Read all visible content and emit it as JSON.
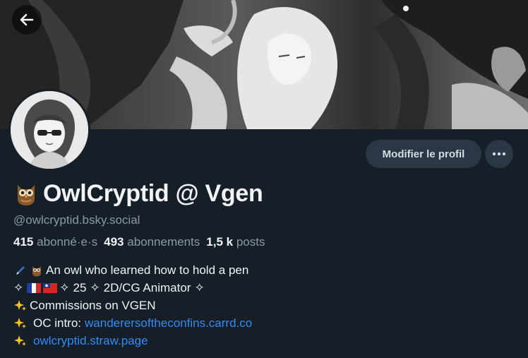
{
  "header": {
    "back_icon": "arrow-left-icon"
  },
  "profile": {
    "display_name": "OwlCryptid @ Vgen",
    "handle": "@owlcryptid.bsky.social",
    "edit_label": "Modifier le profil",
    "more_icon": "ellipsis-icon"
  },
  "stats": {
    "followers_count": "415",
    "followers_label": "abonné·e·s",
    "following_count": "493",
    "following_label": "abonnements",
    "posts_count": "1,5 k",
    "posts_label": "posts"
  },
  "bio": {
    "line1": "An owl who learned how to hold a pen",
    "line2_sep": "✧",
    "line2_age": "25",
    "line2_role": "2D/CG Animator",
    "line3": "Commissions on VGEN",
    "line4_prefix": "OC intro:",
    "line4_link": "wanderersoftheconfins.carrd.co",
    "line5_link": "owlcryptid.straw.page"
  },
  "colors": {
    "background": "#161e27",
    "button_bg": "#2a3744",
    "link": "#2f8df5",
    "muted": "#8a99a8"
  }
}
